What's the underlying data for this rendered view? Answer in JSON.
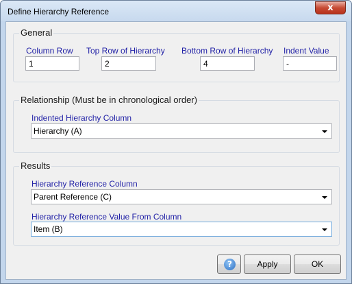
{
  "window": {
    "title": "Define Hierarchy Reference",
    "close_glyph": "x"
  },
  "general": {
    "legend": "General",
    "column_row": {
      "label": "Column Row",
      "value": "1"
    },
    "top_row": {
      "label": "Top Row of Hierarchy",
      "value": "2"
    },
    "bottom_row": {
      "label": "Bottom Row of Hierarchy",
      "value": "4"
    },
    "indent_value": {
      "label": "Indent Value",
      "value": "-"
    }
  },
  "relationship": {
    "legend": "Relationship (Must be in chronological order)",
    "indented_column": {
      "label": "Indented Hierarchy Column",
      "value": "Hierarchy (A)"
    }
  },
  "results": {
    "legend": "Results",
    "reference_column": {
      "label": "Hierarchy Reference Column",
      "value": "Parent Reference (C)"
    },
    "value_from_column": {
      "label": "Hierarchy Reference Value From Column",
      "value": "Item (B)"
    }
  },
  "buttons": {
    "help_glyph": "?",
    "apply": "Apply",
    "ok": "OK"
  },
  "colors": {
    "label_blue": "#1f1fa6",
    "window_frame": "#c3d6ec"
  }
}
